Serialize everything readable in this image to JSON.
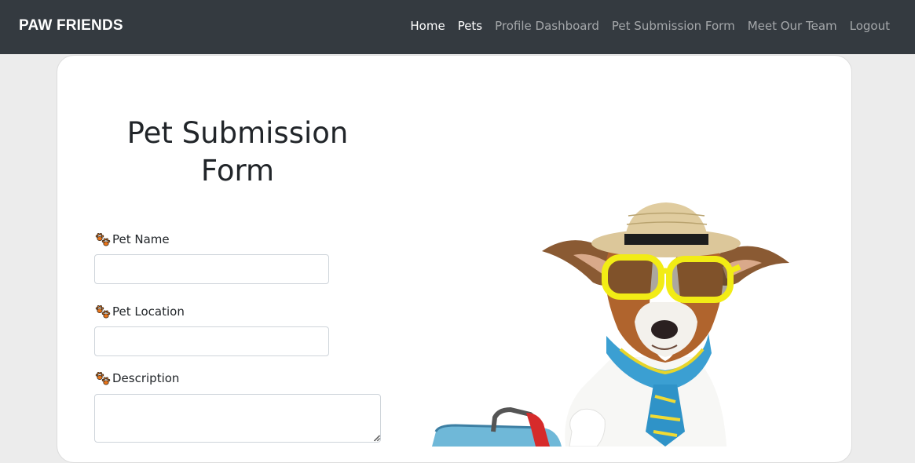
{
  "navbar": {
    "brand": "PAW FRIENDS",
    "links": [
      {
        "label": "Home",
        "active": true
      },
      {
        "label": "Pets",
        "active": true
      },
      {
        "label": "Profile Dashboard",
        "active": false
      },
      {
        "label": "Pet Submission Form",
        "active": false
      },
      {
        "label": "Meet Our Team",
        "active": false
      },
      {
        "label": "Logout",
        "active": false
      }
    ]
  },
  "form": {
    "title": "Pet Submission Form",
    "fields": {
      "pet_name": {
        "label": "Pet Name",
        "value": "",
        "placeholder": ""
      },
      "pet_location": {
        "label": "Pet Location",
        "value": "",
        "placeholder": ""
      },
      "description": {
        "label": "Description",
        "value": "",
        "placeholder": ""
      }
    },
    "label_icon": "paw-prints-icon"
  },
  "image": {
    "subject": "dog-with-hat-and-sunglasses"
  },
  "colors": {
    "navbar_bg": "#343a40",
    "page_bg": "#ececec",
    "card_bg": "#ffffff",
    "paw_orange": "#e8741a"
  }
}
